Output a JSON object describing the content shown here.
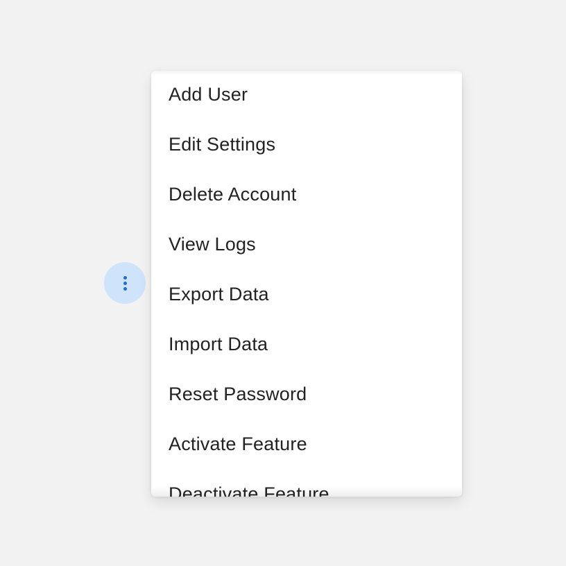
{
  "trigger": {
    "icon": "kebab-vertical-icon",
    "accent_color": "#1a6fd6",
    "background_color": "#cfe3fb"
  },
  "menu": {
    "items": [
      {
        "label": "Add User"
      },
      {
        "label": "Edit Settings"
      },
      {
        "label": "Delete Account"
      },
      {
        "label": "View Logs"
      },
      {
        "label": "Export Data"
      },
      {
        "label": "Import Data"
      },
      {
        "label": "Reset Password"
      },
      {
        "label": "Activate Feature"
      },
      {
        "label": "Deactivate Feature"
      }
    ]
  }
}
